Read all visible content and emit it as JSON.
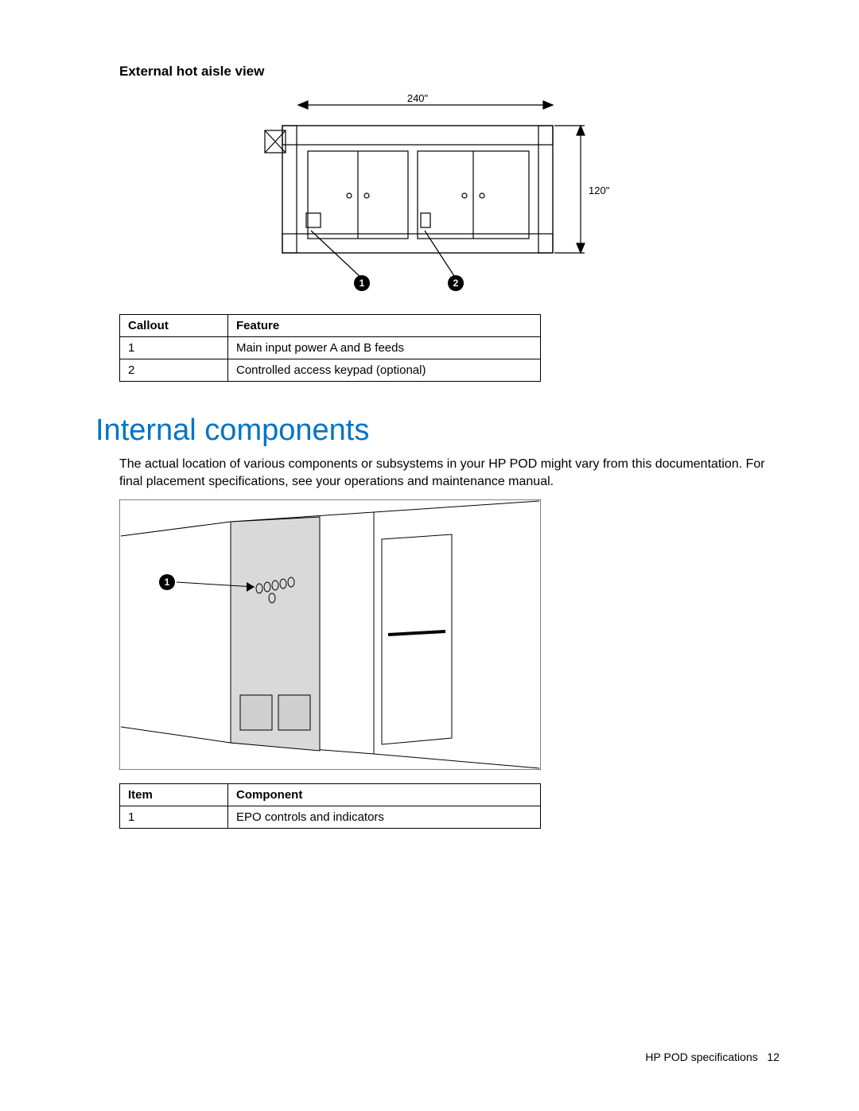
{
  "section_heading": "External hot aisle view",
  "diagram1": {
    "width_label": "240\"",
    "height_label": "120\"",
    "callouts": [
      "1",
      "2"
    ]
  },
  "table1": {
    "headers": {
      "c1": "Callout",
      "c2": "Feature"
    },
    "rows": [
      {
        "c1": "1",
        "c2": "Main input power A and B feeds"
      },
      {
        "c1": "2",
        "c2": "Controlled access keypad (optional)"
      }
    ]
  },
  "main_heading": "Internal components",
  "body_text": "The actual location of various components or subsystems in your HP POD might vary from this documentation. For final placement specifications, see your operations and maintenance manual.",
  "diagram2": {
    "callouts": [
      "1"
    ]
  },
  "table2": {
    "headers": {
      "c1": "Item",
      "c2": "Component"
    },
    "rows": [
      {
        "c1": "1",
        "c2": "EPO controls and indicators"
      }
    ]
  },
  "footer": {
    "label": "HP POD specifications",
    "page": "12"
  }
}
